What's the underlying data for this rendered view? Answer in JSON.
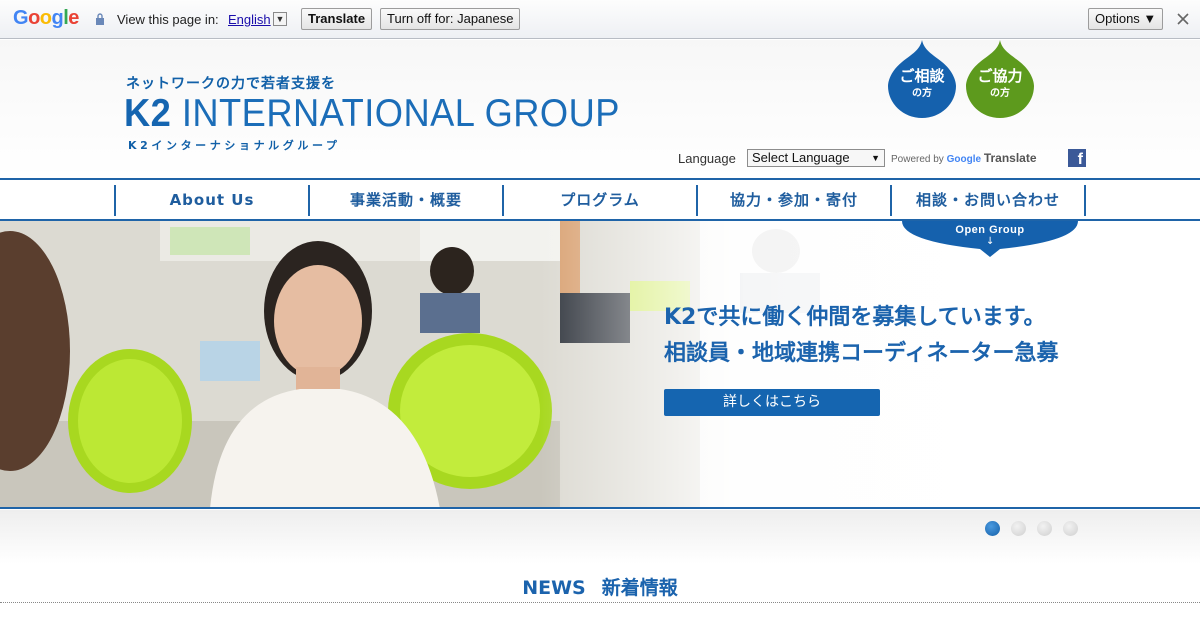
{
  "translate_bar": {
    "view_text": "View this page in:",
    "language": "English",
    "translate_button": "Translate",
    "turn_off_button": "Turn off for: Japanese",
    "options_button": "Options ▼"
  },
  "header": {
    "tagline": "ネットワークの力で若者支援を",
    "brand_k2": "K2",
    "brand_rest": " INTERNATIONAL GROUP",
    "brand_kana": "K2インターナショナルグループ",
    "consult_button": {
      "title": "ご相談",
      "sub": "の方"
    },
    "support_button": {
      "title": "ご協力",
      "sub": "の方"
    },
    "language_label": "Language",
    "language_select": "Select Language",
    "powered_by": "Powered by",
    "google": "Google",
    "translate": "Translate",
    "facebook_glyph": "f"
  },
  "nav": {
    "items": [
      "About Us",
      "事業活動・概要",
      "プログラム",
      "協力・参加・寄付",
      "相談・お問い合わせ"
    ]
  },
  "hero": {
    "open_group": "Open Group",
    "open_group_arrow": "↓",
    "headline_line1": "K2で共に働く仲間を募集しています。",
    "headline_line2": "相談員・地域連携コーディネーター急募",
    "cta": "詳しくはこちら"
  },
  "slider": {
    "count": 4,
    "active": 1
  },
  "news": {
    "title_en": "NEWS",
    "title_ja": "新着情報"
  },
  "colors": {
    "brand_blue": "#1565b0",
    "consult": "#1561ad",
    "support": "#5d9a1d",
    "chair_green": "#a8d820"
  }
}
